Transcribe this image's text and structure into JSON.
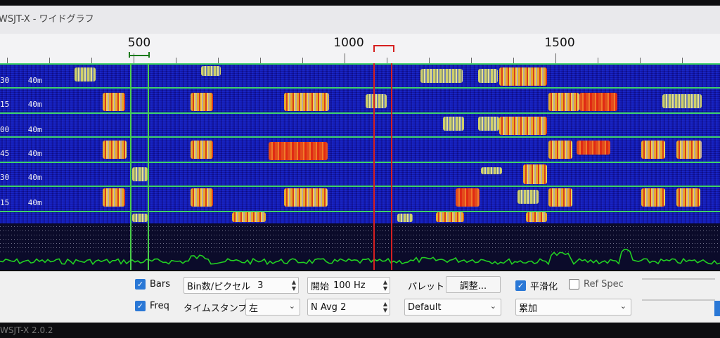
{
  "window": {
    "title": "WSJT-X - ワイドグラフ",
    "status_fragment": "WSJT-X   2.0.2"
  },
  "freq_axis": {
    "labels": [
      "500",
      "1000",
      "1500"
    ]
  },
  "waterfall": {
    "rows": [
      {
        "time": "30",
        "band": "40m"
      },
      {
        "time": "15",
        "band": "40m"
      },
      {
        "time": "00",
        "band": "40m"
      },
      {
        "time": "45",
        "band": "40m"
      },
      {
        "time": "30",
        "band": "40m"
      },
      {
        "time": "15",
        "band": "40m"
      }
    ]
  },
  "controls": {
    "bars": {
      "label": "Bars",
      "checked": true
    },
    "freq": {
      "label": "Freq",
      "checked": true
    },
    "bins_per_pixel": {
      "label": "Bin数/ピクセル",
      "value": "3"
    },
    "start": {
      "label": "開始",
      "value": "100 Hz"
    },
    "palette": {
      "label": "パレット",
      "adjust_button": "調整...",
      "selected": "Default"
    },
    "smoothing": {
      "label": "平滑化",
      "checked": true
    },
    "ref_spec": {
      "label": "Ref Spec",
      "checked": false
    },
    "timestamp": {
      "label": "タイムスタンプ",
      "selected": "左"
    },
    "navg": {
      "value": "N Avg 2"
    },
    "accumulate": {
      "selected": "累加"
    }
  },
  "colors": {
    "waterfall_bg": "#13119e",
    "row_separator": "#3ed16a",
    "tx_marker": "#d62020",
    "rx_marker": "#1a7a1a",
    "spectrum_trace": "#22d022",
    "checkbox_accent": "#2a78d6"
  }
}
